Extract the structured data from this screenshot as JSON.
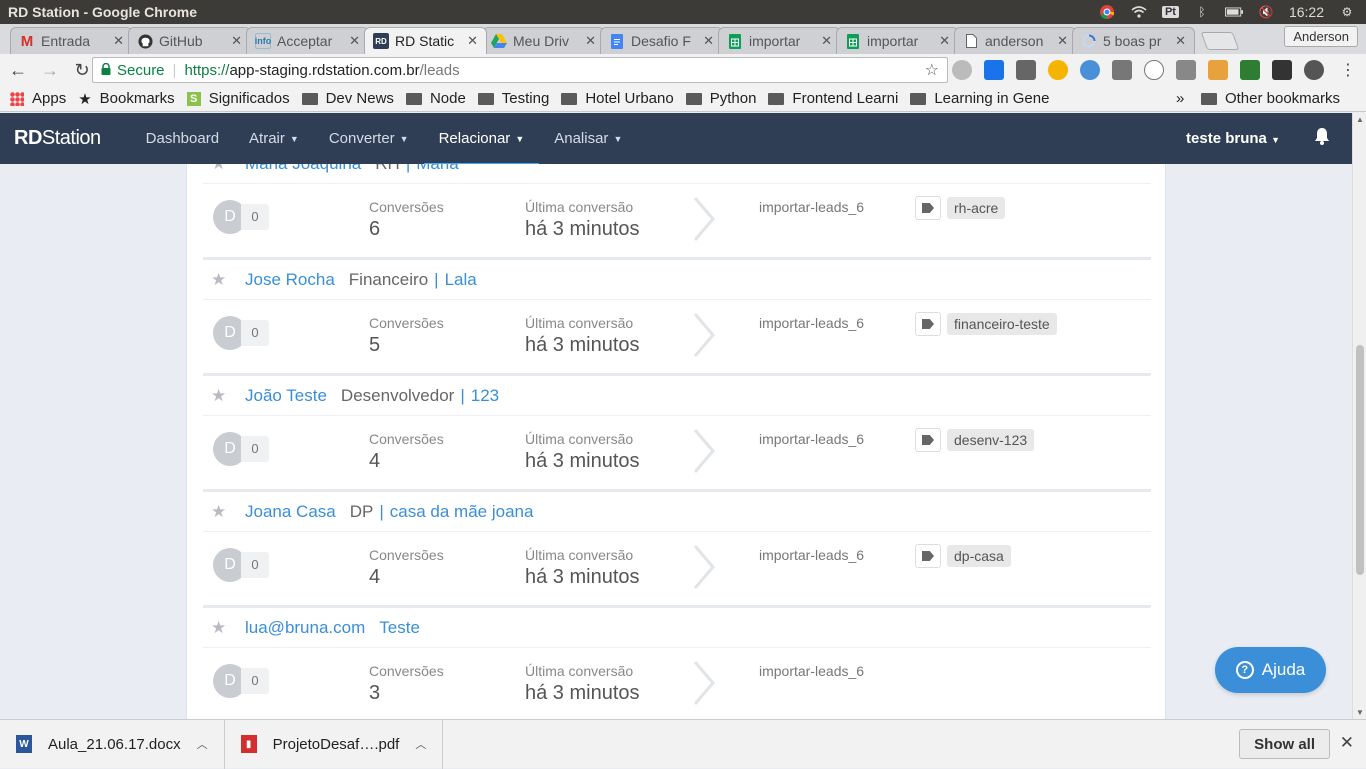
{
  "os": {
    "window_title": "RD Station - Google Chrome",
    "lang": "Pt",
    "clock": "16:22"
  },
  "tabs": [
    {
      "label": "Entrada",
      "icon": "gmail-icon",
      "color": "#d93025"
    },
    {
      "label": "GitHub",
      "icon": "github-icon",
      "color": "#333333"
    },
    {
      "label": "Acceptar",
      "icon": "info-icon",
      "color": "#2a7ab0"
    },
    {
      "label": "RD Static",
      "icon": "rd-station-icon",
      "color": "#2f3e55"
    },
    {
      "label": "Meu Driv",
      "icon": "google-drive-icon",
      "color": "#1fa463"
    },
    {
      "label": "Desafio F",
      "icon": "google-docs-icon",
      "color": "#4285f4"
    },
    {
      "label": "importar",
      "icon": "google-sheets-icon",
      "color": "#0f9d58"
    },
    {
      "label": "importar",
      "icon": "google-sheets-icon",
      "color": "#0f9d58"
    },
    {
      "label": "anderson",
      "icon": "file-icon",
      "color": "#777777"
    },
    {
      "label": "5 boas pr",
      "icon": "loading-icon",
      "color": "#6ea0d8"
    }
  ],
  "profile_name": "Anderson",
  "omnibox": {
    "secure_label": "Secure",
    "scheme": "https://",
    "host": "app-staging.rdstation.com.br",
    "path": "/leads"
  },
  "bookmarks": {
    "items": [
      "Apps",
      "Bookmarks",
      "Significados",
      "Dev News",
      "Node",
      "Testing",
      "Hotel Urbano",
      "Python",
      "Frontend Learni",
      "Learning in Gene"
    ],
    "overflow": "»",
    "other": "Other bookmarks"
  },
  "appnav": {
    "logo_bold": "RD",
    "logo_rest": "Station",
    "items": [
      "Dashboard",
      "Atrair",
      "Converter",
      "Relacionar",
      "Analisar"
    ],
    "active": "Relacionar",
    "user": "teste bruna"
  },
  "leads": [
    {
      "name": "Maria Joaquina",
      "role": "RH",
      "sep": "|",
      "company": "Maria",
      "avatar": "D",
      "score": "0",
      "conv_label": "Conversões",
      "conv": "6",
      "last_label": "Última conversão",
      "last": "há 3 minutos",
      "source": "importar-leads_6",
      "tag": "rh-acre"
    },
    {
      "name": "Jose Rocha",
      "role": "Financeiro",
      "sep": "|",
      "company": "Lala",
      "avatar": "D",
      "score": "0",
      "conv_label": "Conversões",
      "conv": "5",
      "last_label": "Última conversão",
      "last": "há 3 minutos",
      "source": "importar-leads_6",
      "tag": "financeiro-teste"
    },
    {
      "name": "João Teste",
      "role": "Desenvolvedor",
      "sep": "|",
      "company": "123",
      "avatar": "D",
      "score": "0",
      "conv_label": "Conversões",
      "conv": "4",
      "last_label": "Última conversão",
      "last": "há 3 minutos",
      "source": "importar-leads_6",
      "tag": "desenv-123"
    },
    {
      "name": "Joana Casa",
      "role": "DP",
      "sep": "|",
      "company": "casa da mãe joana",
      "avatar": "D",
      "score": "0",
      "conv_label": "Conversões",
      "conv": "4",
      "last_label": "Última conversão",
      "last": "há 3 minutos",
      "source": "importar-leads_6",
      "tag": "dp-casa"
    },
    {
      "name": "lua@bruna.com",
      "role": "",
      "sep": "",
      "company": "Teste",
      "avatar": "D",
      "score": "0",
      "conv_label": "Conversões",
      "conv": "3",
      "last_label": "Última conversão",
      "last": "há 3 minutos",
      "source": "importar-leads_6",
      "tag": ""
    }
  ],
  "help_label": "Ajuda",
  "downloads": [
    {
      "name": "Aula_21.06.17.docx",
      "icon": "word-doc-icon",
      "color": "#2b579a"
    },
    {
      "name": "ProjetoDesaf….pdf",
      "icon": "pdf-icon",
      "color": "#d32f2f"
    }
  ],
  "show_all_label": "Show all"
}
